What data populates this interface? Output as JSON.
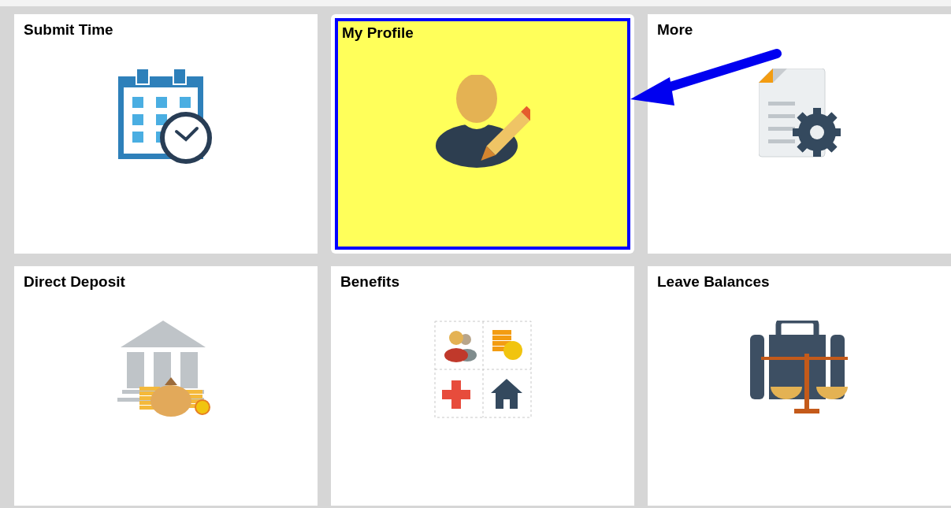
{
  "tiles": [
    {
      "title": "Submit Time",
      "kind": "calendar",
      "highlighted": false
    },
    {
      "title": "My Profile",
      "kind": "profile",
      "highlighted": true
    },
    {
      "title": "More",
      "kind": "document",
      "highlighted": false
    },
    {
      "title": "Direct Deposit",
      "kind": "bank",
      "highlighted": false
    },
    {
      "title": "Benefits",
      "kind": "benefits",
      "highlighted": false
    },
    {
      "title": "Leave Balances",
      "kind": "suitcase",
      "highlighted": false
    }
  ],
  "annotation": {
    "kind": "arrow"
  }
}
